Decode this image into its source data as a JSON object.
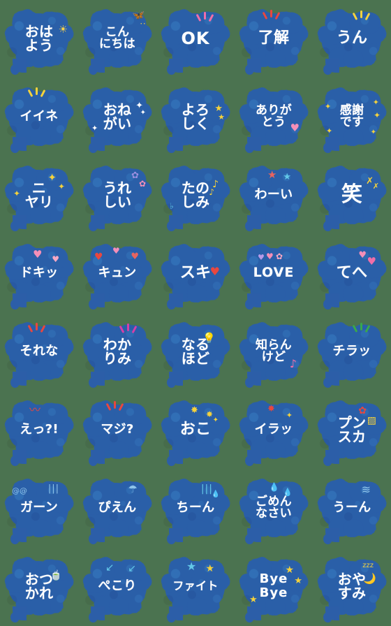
{
  "page": {
    "title": "Speech Bubble Emoji Set",
    "background_color": "#4b7350",
    "bubble_color": "#2c5ea8",
    "text_color": "#ffffff",
    "columns": 5,
    "rows": 8,
    "total_stickers": 40
  },
  "palette": {
    "bubble_blue": "#2c5ea8",
    "bg_green": "#4b7350",
    "white": "#ffffff",
    "yellow": "#f5d23c",
    "pink": "#f48fb8",
    "red": "#e8473f",
    "cyan": "#63c8e8",
    "magenta": "#d63fa8",
    "green_accent": "#3aa84a",
    "sky_blue": "#8fc4ea"
  },
  "stickers": [
    {
      "id": 1,
      "text": "おは\nよう",
      "size": "s2",
      "deco": "sun",
      "deco_label": "sun-icon"
    },
    {
      "id": 2,
      "text": "こん\nにちは",
      "size": "s3",
      "deco": "butterfly",
      "deco_label": "butterfly-icon"
    },
    {
      "id": 3,
      "text": "OK",
      "size": "ok",
      "deco": "pink-rays",
      "deco_label": "pink-rays-icon"
    },
    {
      "id": 4,
      "text": "了解",
      "size": "s4",
      "deco": "red-rays",
      "deco_label": "red-rays-icon"
    },
    {
      "id": 5,
      "text": "うん",
      "size": "s4",
      "deco": "yellow-rays",
      "deco_label": "yellow-rays-icon"
    },
    {
      "id": 6,
      "text": "イイネ",
      "size": "s6",
      "deco": "yellow-rays-top",
      "deco_label": "yellow-rays-icon"
    },
    {
      "id": 7,
      "text": "おね\nがい",
      "size": "s2",
      "deco": "sparkles-white",
      "deco_label": "sparkle-icon"
    },
    {
      "id": 8,
      "text": "よろ\nしく",
      "size": "s2",
      "deco": "yellow-stars",
      "deco_label": "star-icon"
    },
    {
      "id": 9,
      "text": "ありが\nとう",
      "size": "s3",
      "deco": "pink-heart",
      "deco_label": "heart-icon"
    },
    {
      "id": 10,
      "text": "感謝\nです",
      "size": "s3",
      "deco": "yellow-sparkles",
      "deco_label": "sparkle-icon"
    },
    {
      "id": 11,
      "text": "ニ\nヤリ",
      "size": "s2",
      "deco": "yellow-diamonds",
      "deco_label": "sparkle-icon"
    },
    {
      "id": 12,
      "text": "うれ\nしい",
      "size": "s2",
      "deco": "flowers",
      "deco_label": "flower-icon"
    },
    {
      "id": 13,
      "text": "たの\nしみ",
      "size": "s2",
      "deco": "music-notes",
      "deco_label": "music-note-icon"
    },
    {
      "id": 14,
      "text": "わーい",
      "size": "s6",
      "deco": "two-stars",
      "deco_label": "star-icon"
    },
    {
      "id": 15,
      "text": "笑",
      "size": "s5",
      "deco": "yellow-birds",
      "deco_label": "bird-icon"
    },
    {
      "id": 16,
      "text": "ドキッ",
      "size": "s6",
      "deco": "pink-hearts",
      "deco_label": "heart-icon"
    },
    {
      "id": 17,
      "text": "キュン",
      "size": "s6",
      "deco": "red-hearts",
      "deco_label": "heart-icon"
    },
    {
      "id": 18,
      "text": "スキ",
      "size": "s4",
      "deco": "red-heart-side",
      "deco_label": "heart-icon"
    },
    {
      "id": 19,
      "text": "LOVE",
      "size": "love",
      "deco": "heart-row",
      "deco_label": "heart-icon"
    },
    {
      "id": 20,
      "text": "てへ",
      "size": "s4",
      "deco": "pink-hearts-top",
      "deco_label": "heart-icon"
    },
    {
      "id": 21,
      "text": "それな",
      "size": "s6",
      "deco": "red-rays",
      "deco_label": "red-rays-icon"
    },
    {
      "id": 22,
      "text": "わか\nりみ",
      "size": "s2",
      "deco": "magenta-rays",
      "deco_label": "magenta-rays-icon"
    },
    {
      "id": 23,
      "text": "なる\nほど",
      "size": "s2",
      "deco": "lightbulb",
      "deco_label": "lightbulb-icon"
    },
    {
      "id": 24,
      "text": "知らん\nけど",
      "size": "s3",
      "deco": "pink-note",
      "deco_label": "music-note-icon"
    },
    {
      "id": 25,
      "text": "チラッ",
      "size": "s6",
      "deco": "green-rays",
      "deco_label": "green-rays-icon"
    },
    {
      "id": 26,
      "text": "えっ?!",
      "size": "s6",
      "deco": "red-squiggle",
      "deco_label": "squiggle-icon"
    },
    {
      "id": 27,
      "text": "マジ?",
      "size": "s6",
      "deco": "red-rays",
      "deco_label": "red-rays-icon"
    },
    {
      "id": 28,
      "text": "おこ",
      "size": "s4",
      "deco": "anger-sparks",
      "deco_label": "anger-icon"
    },
    {
      "id": 29,
      "text": "イラッ",
      "size": "s6",
      "deco": "anger-mark",
      "deco_label": "anger-icon"
    },
    {
      "id": 30,
      "text": "プン\nスカ",
      "size": "s2",
      "deco": "anger-steam",
      "deco_label": "anger-icon"
    },
    {
      "id": 31,
      "text": "ガーン",
      "size": "s6",
      "deco": "shock-lines",
      "deco_label": "shock-lines-icon"
    },
    {
      "id": 32,
      "text": "ぴえん",
      "size": "s6",
      "deco": "tear-drop",
      "deco_label": "teardrop-icon"
    },
    {
      "id": 33,
      "text": "ちーん",
      "size": "s6",
      "deco": "blue-lines",
      "deco_label": "gloom-lines-icon"
    },
    {
      "id": 34,
      "text": "ごめん\nなさい",
      "size": "s3",
      "deco": "sweat-drops",
      "deco_label": "sweatdrop-icon"
    },
    {
      "id": 35,
      "text": "うーん",
      "size": "s6",
      "deco": "think-swirl",
      "deco_label": "thinking-icon"
    },
    {
      "id": 36,
      "text": "おつ\nかれ",
      "size": "s2",
      "deco": "beer-mug",
      "deco_label": "drink-icon"
    },
    {
      "id": 37,
      "text": "ぺこり",
      "size": "s6",
      "deco": "bow-arrows",
      "deco_label": "arrow-icon"
    },
    {
      "id": 38,
      "text": "ファイト",
      "size": "s7",
      "deco": "two-stars-cy",
      "deco_label": "star-icon"
    },
    {
      "id": 39,
      "text": "Bye\nBye",
      "size": "bye",
      "deco": "yellow-stars-3",
      "deco_label": "star-icon"
    },
    {
      "id": 40,
      "text": "おや\nすみ",
      "size": "s2",
      "deco": "moon-zzz",
      "deco_label": "moon-icon"
    }
  ]
}
